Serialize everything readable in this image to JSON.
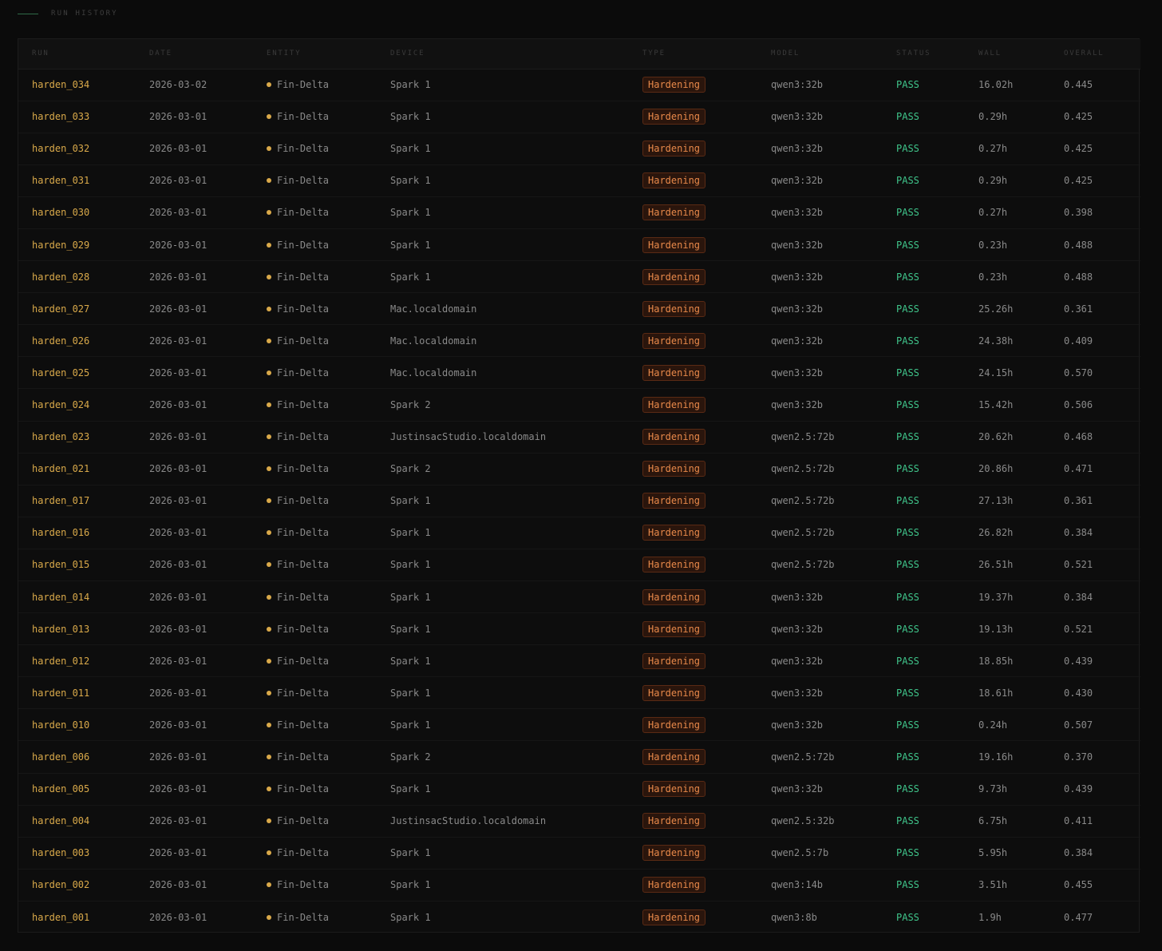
{
  "section": {
    "title": "RUN HISTORY"
  },
  "colors": {
    "accent": "#d9a94a",
    "badge": "#e8894a",
    "pass": "#3fc48a"
  },
  "table": {
    "columns": [
      "RUN",
      "DATE",
      "ENTITY",
      "DEVICE",
      "TYPE",
      "MODEL",
      "STATUS",
      "WALL",
      "OVERALL"
    ],
    "rows": [
      {
        "run": "harden_034",
        "date": "2026-03-02",
        "entity": "Fin-Delta",
        "device": "Spark 1",
        "type": "Hardening",
        "model": "qwen3:32b",
        "status": "PASS",
        "wall": "16.02h",
        "overall": "0.445"
      },
      {
        "run": "harden_033",
        "date": "2026-03-01",
        "entity": "Fin-Delta",
        "device": "Spark 1",
        "type": "Hardening",
        "model": "qwen3:32b",
        "status": "PASS",
        "wall": "0.29h",
        "overall": "0.425"
      },
      {
        "run": "harden_032",
        "date": "2026-03-01",
        "entity": "Fin-Delta",
        "device": "Spark 1",
        "type": "Hardening",
        "model": "qwen3:32b",
        "status": "PASS",
        "wall": "0.27h",
        "overall": "0.425"
      },
      {
        "run": "harden_031",
        "date": "2026-03-01",
        "entity": "Fin-Delta",
        "device": "Spark 1",
        "type": "Hardening",
        "model": "qwen3:32b",
        "status": "PASS",
        "wall": "0.29h",
        "overall": "0.425"
      },
      {
        "run": "harden_030",
        "date": "2026-03-01",
        "entity": "Fin-Delta",
        "device": "Spark 1",
        "type": "Hardening",
        "model": "qwen3:32b",
        "status": "PASS",
        "wall": "0.27h",
        "overall": "0.398"
      },
      {
        "run": "harden_029",
        "date": "2026-03-01",
        "entity": "Fin-Delta",
        "device": "Spark 1",
        "type": "Hardening",
        "model": "qwen3:32b",
        "status": "PASS",
        "wall": "0.23h",
        "overall": "0.488"
      },
      {
        "run": "harden_028",
        "date": "2026-03-01",
        "entity": "Fin-Delta",
        "device": "Spark 1",
        "type": "Hardening",
        "model": "qwen3:32b",
        "status": "PASS",
        "wall": "0.23h",
        "overall": "0.488"
      },
      {
        "run": "harden_027",
        "date": "2026-03-01",
        "entity": "Fin-Delta",
        "device": "Mac.localdomain",
        "type": "Hardening",
        "model": "qwen3:32b",
        "status": "PASS",
        "wall": "25.26h",
        "overall": "0.361"
      },
      {
        "run": "harden_026",
        "date": "2026-03-01",
        "entity": "Fin-Delta",
        "device": "Mac.localdomain",
        "type": "Hardening",
        "model": "qwen3:32b",
        "status": "PASS",
        "wall": "24.38h",
        "overall": "0.409"
      },
      {
        "run": "harden_025",
        "date": "2026-03-01",
        "entity": "Fin-Delta",
        "device": "Mac.localdomain",
        "type": "Hardening",
        "model": "qwen3:32b",
        "status": "PASS",
        "wall": "24.15h",
        "overall": "0.570"
      },
      {
        "run": "harden_024",
        "date": "2026-03-01",
        "entity": "Fin-Delta",
        "device": "Spark 2",
        "type": "Hardening",
        "model": "qwen3:32b",
        "status": "PASS",
        "wall": "15.42h",
        "overall": "0.506"
      },
      {
        "run": "harden_023",
        "date": "2026-03-01",
        "entity": "Fin-Delta",
        "device": "JustinsacStudio.localdomain",
        "type": "Hardening",
        "model": "qwen2.5:72b",
        "status": "PASS",
        "wall": "20.62h",
        "overall": "0.468"
      },
      {
        "run": "harden_021",
        "date": "2026-03-01",
        "entity": "Fin-Delta",
        "device": "Spark 2",
        "type": "Hardening",
        "model": "qwen2.5:72b",
        "status": "PASS",
        "wall": "20.86h",
        "overall": "0.471"
      },
      {
        "run": "harden_017",
        "date": "2026-03-01",
        "entity": "Fin-Delta",
        "device": "Spark 1",
        "type": "Hardening",
        "model": "qwen2.5:72b",
        "status": "PASS",
        "wall": "27.13h",
        "overall": "0.361"
      },
      {
        "run": "harden_016",
        "date": "2026-03-01",
        "entity": "Fin-Delta",
        "device": "Spark 1",
        "type": "Hardening",
        "model": "qwen2.5:72b",
        "status": "PASS",
        "wall": "26.82h",
        "overall": "0.384"
      },
      {
        "run": "harden_015",
        "date": "2026-03-01",
        "entity": "Fin-Delta",
        "device": "Spark 1",
        "type": "Hardening",
        "model": "qwen2.5:72b",
        "status": "PASS",
        "wall": "26.51h",
        "overall": "0.521"
      },
      {
        "run": "harden_014",
        "date": "2026-03-01",
        "entity": "Fin-Delta",
        "device": "Spark 1",
        "type": "Hardening",
        "model": "qwen3:32b",
        "status": "PASS",
        "wall": "19.37h",
        "overall": "0.384"
      },
      {
        "run": "harden_013",
        "date": "2026-03-01",
        "entity": "Fin-Delta",
        "device": "Spark 1",
        "type": "Hardening",
        "model": "qwen3:32b",
        "status": "PASS",
        "wall": "19.13h",
        "overall": "0.521"
      },
      {
        "run": "harden_012",
        "date": "2026-03-01",
        "entity": "Fin-Delta",
        "device": "Spark 1",
        "type": "Hardening",
        "model": "qwen3:32b",
        "status": "PASS",
        "wall": "18.85h",
        "overall": "0.439"
      },
      {
        "run": "harden_011",
        "date": "2026-03-01",
        "entity": "Fin-Delta",
        "device": "Spark 1",
        "type": "Hardening",
        "model": "qwen3:32b",
        "status": "PASS",
        "wall": "18.61h",
        "overall": "0.430"
      },
      {
        "run": "harden_010",
        "date": "2026-03-01",
        "entity": "Fin-Delta",
        "device": "Spark 1",
        "type": "Hardening",
        "model": "qwen3:32b",
        "status": "PASS",
        "wall": "0.24h",
        "overall": "0.507"
      },
      {
        "run": "harden_006",
        "date": "2026-03-01",
        "entity": "Fin-Delta",
        "device": "Spark 2",
        "type": "Hardening",
        "model": "qwen2.5:72b",
        "status": "PASS",
        "wall": "19.16h",
        "overall": "0.370"
      },
      {
        "run": "harden_005",
        "date": "2026-03-01",
        "entity": "Fin-Delta",
        "device": "Spark 1",
        "type": "Hardening",
        "model": "qwen3:32b",
        "status": "PASS",
        "wall": "9.73h",
        "overall": "0.439"
      },
      {
        "run": "harden_004",
        "date": "2026-03-01",
        "entity": "Fin-Delta",
        "device": "JustinsacStudio.localdomain",
        "type": "Hardening",
        "model": "qwen2.5:32b",
        "status": "PASS",
        "wall": "6.75h",
        "overall": "0.411"
      },
      {
        "run": "harden_003",
        "date": "2026-03-01",
        "entity": "Fin-Delta",
        "device": "Spark 1",
        "type": "Hardening",
        "model": "qwen2.5:7b",
        "status": "PASS",
        "wall": "5.95h",
        "overall": "0.384"
      },
      {
        "run": "harden_002",
        "date": "2026-03-01",
        "entity": "Fin-Delta",
        "device": "Spark 1",
        "type": "Hardening",
        "model": "qwen3:14b",
        "status": "PASS",
        "wall": "3.51h",
        "overall": "0.455"
      },
      {
        "run": "harden_001",
        "date": "2026-03-01",
        "entity": "Fin-Delta",
        "device": "Spark 1",
        "type": "Hardening",
        "model": "qwen3:8b",
        "status": "PASS",
        "wall": "1.9h",
        "overall": "0.477"
      }
    ]
  }
}
